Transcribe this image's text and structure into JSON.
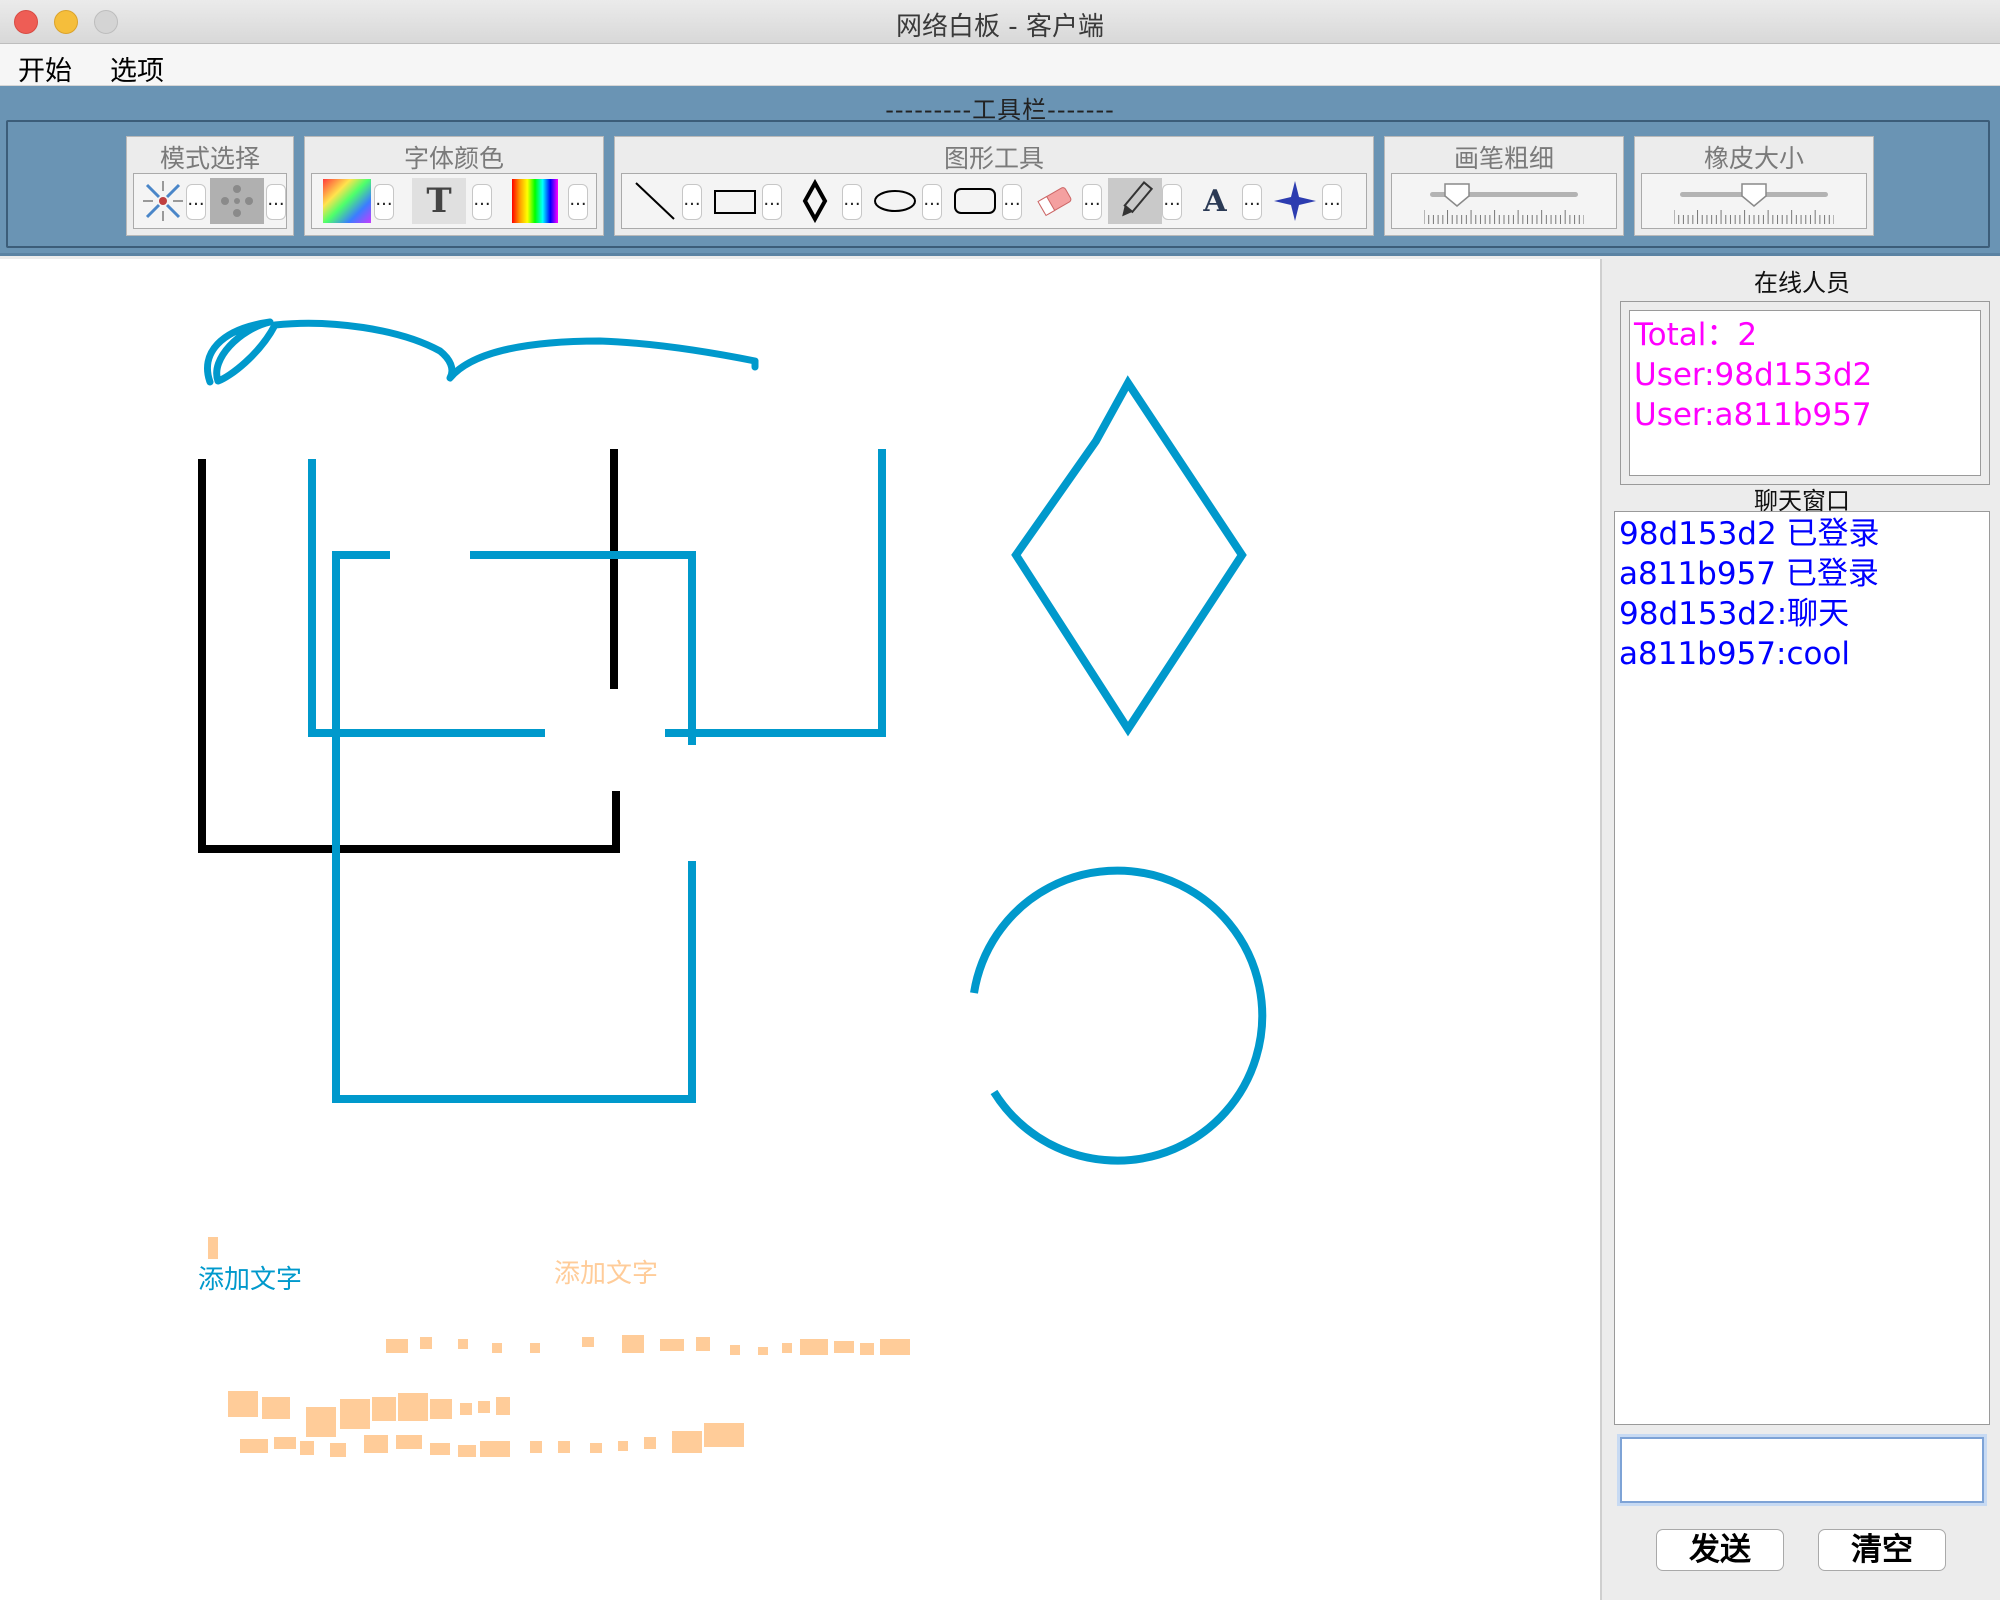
{
  "window": {
    "title": "网络白板 - 客户端"
  },
  "menu": {
    "items": [
      "开始",
      "选项"
    ]
  },
  "toolbar": {
    "title": "---------工具栏-------",
    "groups": {
      "mode": {
        "title": "模式选择",
        "tools": [
          "select-icon",
          "move-icon"
        ]
      },
      "font_color": {
        "title": "字体颜色",
        "tools": [
          "gradient-palette-icon",
          "font-icon",
          "spectrum-palette-icon"
        ]
      },
      "shapes": {
        "title": "图形工具",
        "tools": [
          "line-icon",
          "rectangle-icon",
          "diamond-icon",
          "ellipse-icon",
          "rounded-rectangle-icon",
          "eraser-icon",
          "pen-icon",
          "text-icon",
          "star-icon"
        ],
        "selected": "pen-icon"
      },
      "pen_width": {
        "title": "画笔粗细",
        "level": 0.18
      },
      "eraser_size": {
        "title": "橡皮大小",
        "level": 0.5
      }
    },
    "more_label": "..."
  },
  "canvas": {
    "texts": [
      {
        "text": "添加文字",
        "color": "#0099cc"
      },
      {
        "text": "添加文字",
        "color": "#ffcc99"
      }
    ],
    "stroke_colors": {
      "blue": "#0099cc",
      "black": "#000000",
      "peach": "#ffcc99"
    }
  },
  "sidepanel": {
    "online_title": "在线人员",
    "online_list": [
      "Total：2",
      "User:98d153d2",
      "User:a811b957"
    ],
    "online_color": "#ff00ff",
    "chat_title": "聊天窗口",
    "chat_messages": [
      "98d153d2 已登录",
      "a811b957 已登录",
      "98d153d2:聊天",
      "a811b957:cool"
    ],
    "chat_color": "#0000ff",
    "input_value": "",
    "send_label": "发送",
    "clear_label": "清空"
  }
}
